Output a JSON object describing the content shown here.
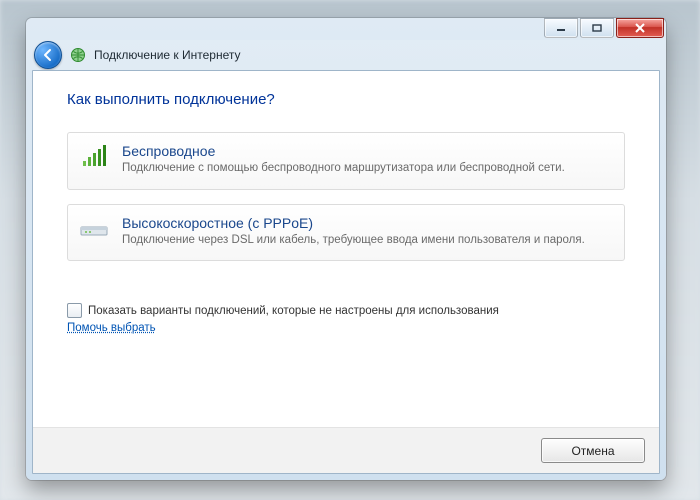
{
  "window": {
    "title": "Подключение к Интернету"
  },
  "heading": "Как выполнить подключение?",
  "options": [
    {
      "title": "Беспроводное",
      "desc": "Подключение с помощью беспроводного маршрутизатора или беспроводной сети."
    },
    {
      "title": "Высокоскоростное (с PPPoE)",
      "desc": "Подключение через DSL или кабель, требующее ввода имени пользователя и пароля."
    }
  ],
  "show_unavailable_label": "Показать варианты подключений, которые не настроены для использования",
  "help_link": "Помочь выбрать",
  "buttons": {
    "cancel": "Отмена"
  }
}
